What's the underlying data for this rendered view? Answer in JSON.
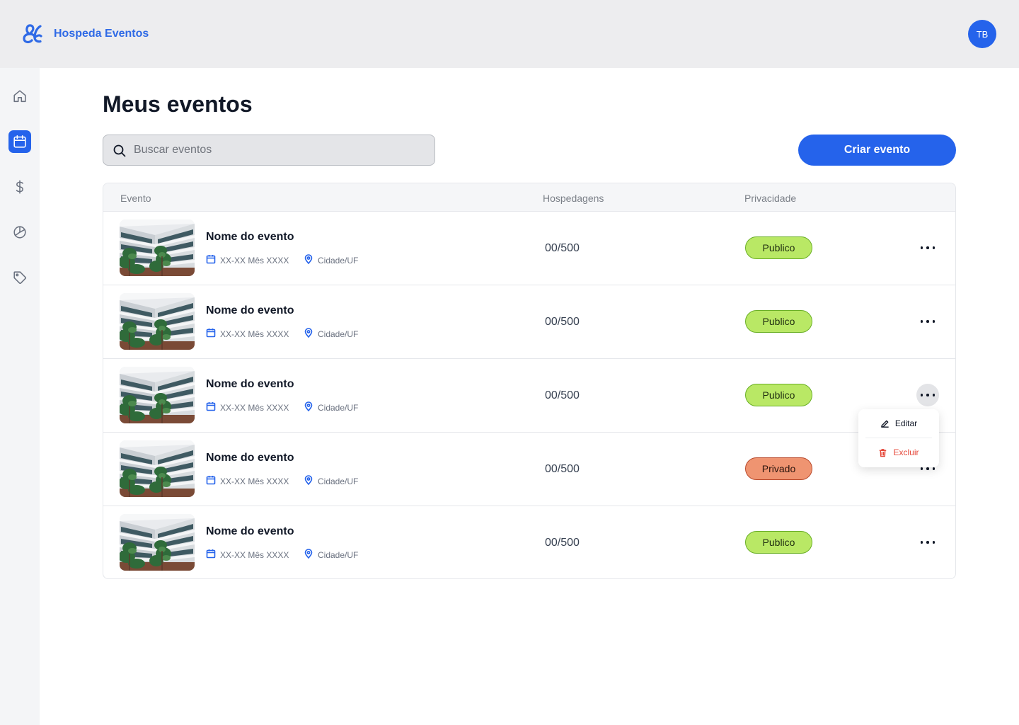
{
  "app": {
    "brand": "Hospeda Eventos",
    "logo_icon": "ampersand-logo-icon",
    "brand_color": "#2f6ae6"
  },
  "user": {
    "initials": "TB"
  },
  "sidebar": {
    "items": [
      {
        "name": "home",
        "icon": "home-icon",
        "active": false
      },
      {
        "name": "events",
        "icon": "calendar-icon",
        "active": true
      },
      {
        "name": "finance",
        "icon": "dollar-icon",
        "active": false
      },
      {
        "name": "reports",
        "icon": "pie-chart-icon",
        "active": false
      },
      {
        "name": "tags",
        "icon": "tag-icon",
        "active": false
      }
    ]
  },
  "page": {
    "title": "Meus eventos"
  },
  "search": {
    "placeholder": "Buscar eventos",
    "value": ""
  },
  "actions": {
    "create_label": "Criar evento"
  },
  "table": {
    "headers": {
      "event": "Evento",
      "lodging": "Hospedagens",
      "privacy": "Privacidade"
    },
    "rows": [
      {
        "name": "Nome do evento",
        "date": "XX-XX Mês XXXX",
        "location": "Cidade/UF",
        "lodging": "00/500",
        "privacy": "Publico",
        "status": "public"
      },
      {
        "name": "Nome do evento",
        "date": "XX-XX Mês XXXX",
        "location": "Cidade/UF",
        "lodging": "00/500",
        "privacy": "Publico",
        "status": "public"
      },
      {
        "name": "Nome do evento",
        "date": "XX-XX Mês XXXX",
        "location": "Cidade/UF",
        "lodging": "00/500",
        "privacy": "Publico",
        "status": "public",
        "menu_open": true
      },
      {
        "name": "Nome do evento",
        "date": "XX-XX Mês XXXX",
        "location": "Cidade/UF",
        "lodging": "00/500",
        "privacy": "Privado",
        "status": "private"
      },
      {
        "name": "Nome do evento",
        "date": "XX-XX Mês XXXX",
        "location": "Cidade/UF",
        "lodging": "00/500",
        "privacy": "Publico",
        "status": "public"
      }
    ]
  },
  "row_menu": {
    "edit": "Editar",
    "delete": "Excluir"
  },
  "colors": {
    "accent": "#2563eb",
    "public_badge": "#b9e865",
    "private_badge": "#ef9471",
    "danger": "#e5483a"
  }
}
